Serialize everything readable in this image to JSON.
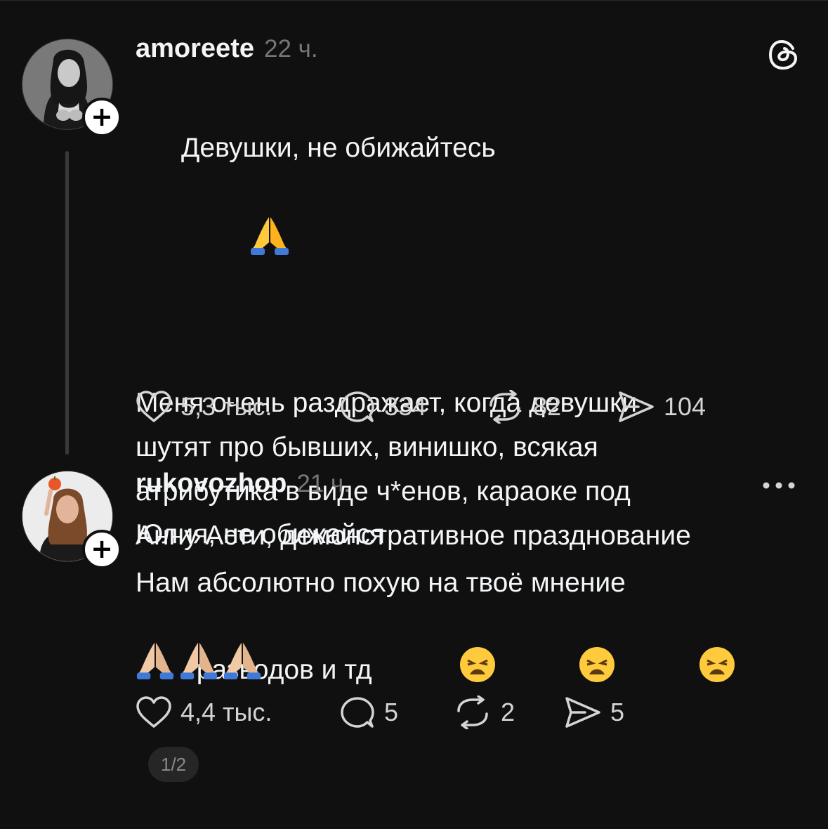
{
  "posts": [
    {
      "username": "amoreete",
      "time": "22 ч.",
      "title_line": "Девушки, не обижайтесь",
      "body_lines": [
        "Меня очень раздражает, когда девушки",
        "шутят про бывших, винишко, всякая",
        "атрибутика в виде ч*енов, караоке под",
        "Анну Асти, демонстративное празднование",
        "разводов и тд"
      ],
      "page_indicator": "1/2",
      "emojis": [
        "praying-hands-emoji",
        "weary-face-emoji",
        "weary-face-emoji",
        "weary-face-emoji"
      ],
      "likes": "5,3 тыс.",
      "replies": "334",
      "reposts": "82",
      "shares": "104",
      "corner_icon": "threads-logo-icon"
    },
    {
      "username": "rukovozhop",
      "time": "21 ч.",
      "lines": [
        "Юлия, не обижайся",
        "Нам абсолютно похую на твоё мнение"
      ],
      "emojis": [
        "praying-hands-emoji",
        "praying-hands-emoji",
        "praying-hands-emoji"
      ],
      "likes": "4,4 тыс.",
      "replies": "5",
      "reposts": "2",
      "shares": "5",
      "corner_icon": "more-options-icon"
    }
  ],
  "colors": {
    "background": "#101010",
    "text": "#f3f5f7",
    "muted": "#777777",
    "thread_line": "#393939"
  }
}
